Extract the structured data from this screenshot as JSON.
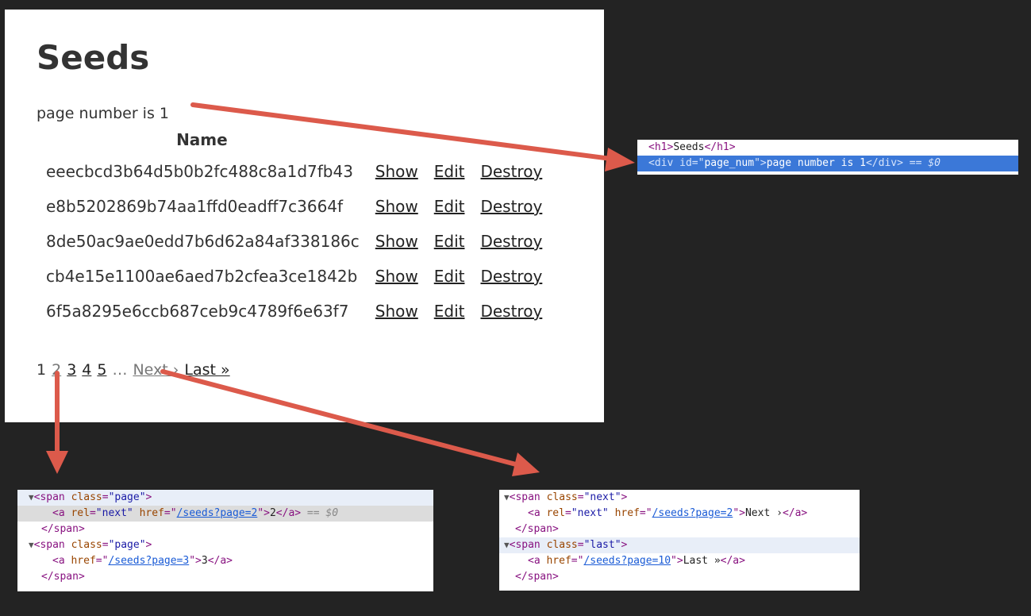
{
  "page": {
    "title": "Seeds",
    "page_number_text": "page number is 1",
    "column_header": "Name",
    "rows": [
      {
        "name": "eeecbcd3b64d5b0b2fc488c8a1d7fb43",
        "show": "Show",
        "edit": "Edit",
        "destroy": "Destroy"
      },
      {
        "name": "e8b5202869b74aa1ffd0eadff7c3664f",
        "show": "Show",
        "edit": "Edit",
        "destroy": "Destroy"
      },
      {
        "name": "8de50ac9ae0edd7b6d62a84af338186c",
        "show": "Show",
        "edit": "Edit",
        "destroy": "Destroy"
      },
      {
        "name": "cb4e15e1100ae6aed7b2cfea3ce1842b",
        "show": "Show",
        "edit": "Edit",
        "destroy": "Destroy"
      },
      {
        "name": "6f5a8295e6ccb687ceb9c4789f6e63f7",
        "show": "Show",
        "edit": "Edit",
        "destroy": "Destroy"
      }
    ],
    "pager": {
      "current": "1",
      "pages": [
        "2",
        "3",
        "4",
        "5"
      ],
      "gap": "…",
      "next": "Next ›",
      "last": "Last »"
    }
  },
  "devtools_top": {
    "line1": {
      "open": "<h1>",
      "text": "Seeds",
      "close": "</h1>"
    },
    "line2": {
      "open": "<div ",
      "attr": "id",
      "eq": "=\"",
      "val": "page_num",
      "end": "\">",
      "text": "page number is 1",
      "close": "</div>",
      "marker": " == $0"
    }
  },
  "devtools_left": {
    "l1": {
      "tag": "<span ",
      "attr": "class",
      "val": "\"page\"",
      "end": ">"
    },
    "l2": {
      "tag": "<a ",
      "attr1": "rel",
      "val1": "\"next\"",
      "attr2": " href",
      "href": "/seeds?page=2",
      "text": "2",
      "close": "</a>",
      "marker": " == $0"
    },
    "l3": "</span>",
    "l4": {
      "tag": "<span ",
      "attr": "class",
      "val": "\"page\"",
      "end": ">"
    },
    "l5": {
      "tag": "<a ",
      "attr": "href",
      "href": "/seeds?page=3",
      "text": "3",
      "close": "</a>"
    },
    "l6": "</span>"
  },
  "devtools_right": {
    "l1": {
      "tag": "<span ",
      "attr": "class",
      "val": "\"next\"",
      "end": ">"
    },
    "l2": {
      "tag": "<a ",
      "attr1": "rel",
      "val1": "\"next\"",
      "attr2": " href",
      "href": "/seeds?page=2",
      "text": "Next ›",
      "close": "</a>"
    },
    "l3": "</span>",
    "l4": {
      "tag": "<span ",
      "attr": "class",
      "val": "\"last\"",
      "end": ">"
    },
    "l5": {
      "tag": "<a ",
      "attr": "href",
      "href": "/seeds?page=10",
      "text": "Last »",
      "close": "</a>"
    },
    "l6": "</span>"
  },
  "colors": {
    "arrow": "#dc5a4b",
    "selection": "#3b78d8"
  }
}
